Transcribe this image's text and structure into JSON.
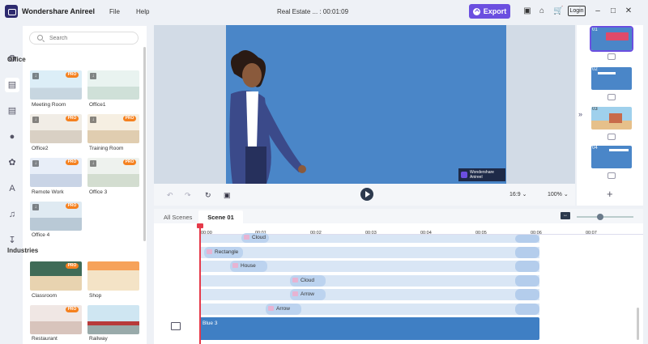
{
  "app": {
    "name": "Wondershare Anireel",
    "project_title": "Real Estate ... : 00:01:09"
  },
  "menu": [
    "File",
    "Help"
  ],
  "toolbar": {
    "export_label": "Export",
    "login_label": "Login"
  },
  "left_panel": {
    "search_placeholder": "Search",
    "categories": [
      {
        "title": "Office",
        "items": [
          {
            "label": "Meeting Room",
            "pro": "PRO"
          },
          {
            "label": "Office1",
            "pro": ""
          },
          {
            "label": "Office2",
            "pro": "PRO"
          },
          {
            "label": "Training Room",
            "pro": "PRO"
          },
          {
            "label": "Remote Work",
            "pro": "PRO"
          },
          {
            "label": "Office 3",
            "pro": "PRO"
          },
          {
            "label": "Office 4",
            "pro": "PRO"
          }
        ]
      },
      {
        "title": "Industries",
        "items": [
          {
            "label": "Classroom",
            "pro": "PRO"
          },
          {
            "label": "Shop",
            "pro": ""
          },
          {
            "label": "Restaurant",
            "pro": "PRO"
          },
          {
            "label": "Railway",
            "pro": ""
          }
        ]
      }
    ]
  },
  "preview": {
    "watermark": "Wondershare Anireel",
    "aspect_ratio": "16:9",
    "zoom": "100%"
  },
  "scenes": [
    {
      "number": "01",
      "color": "#4a86c8"
    },
    {
      "number": "02",
      "color": "#4a86c8"
    },
    {
      "number": "03",
      "color": "#4a86c8"
    },
    {
      "number": "04",
      "color": "#4a86c8"
    }
  ],
  "timeline": {
    "tabs": [
      "All Scenes",
      "Scene 01"
    ],
    "ruler": [
      "00:00",
      "00:01",
      "00:02",
      "00:03",
      "00:04",
      "00:05",
      "00:06",
      "00:07"
    ],
    "tracks": [
      {
        "label": "Cloud"
      },
      {
        "label": "Rectangle"
      },
      {
        "label": "House"
      },
      {
        "label": "Cloud"
      },
      {
        "label": "Arrow"
      },
      {
        "label": "Arrow"
      }
    ],
    "background_clip": "Blue 3"
  },
  "colors": {
    "accent": "#6b4fe0",
    "pro_badge": "#f5811f",
    "canvas": "#4a86c8",
    "playhead": "#e53a4a"
  }
}
